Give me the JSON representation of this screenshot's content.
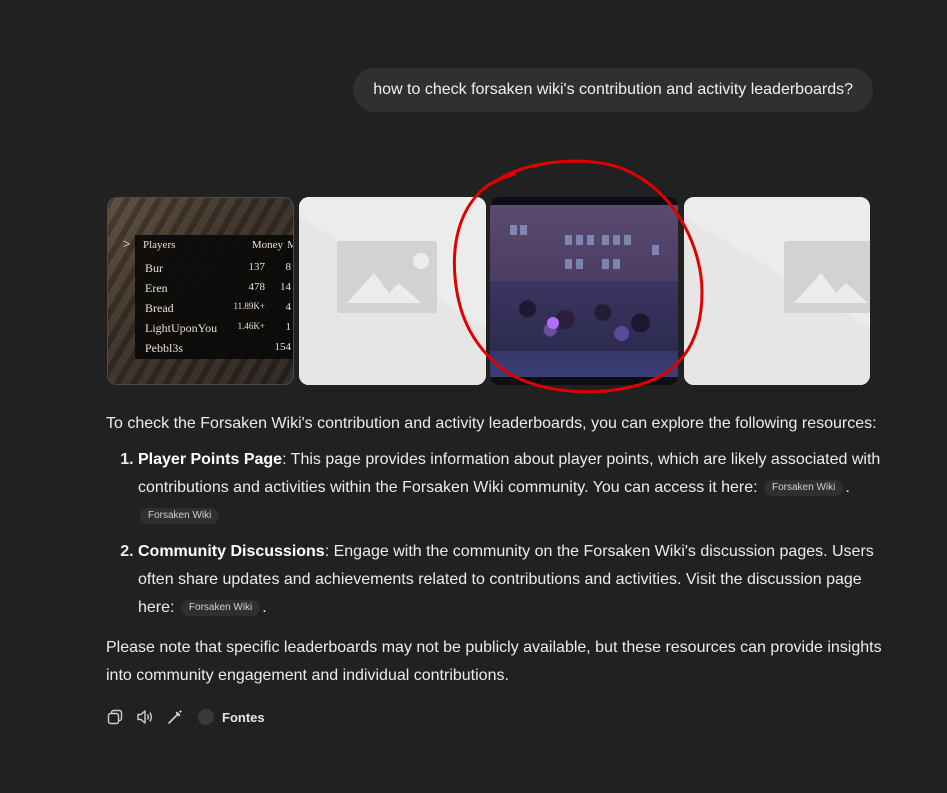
{
  "user_message": "how to check forsaken wiki's contribution and activity leaderboards?",
  "scoreboard": {
    "arrow": ">",
    "headers": [
      "Players",
      "Money",
      "M"
    ],
    "rows": [
      {
        "name": "Bur",
        "money": "137",
        "m": "8"
      },
      {
        "name": "Eren",
        "money": "478",
        "m": "14"
      },
      {
        "name": "Bread",
        "money": "11.89K+",
        "m": "4"
      },
      {
        "name": "LightUponYou",
        "money": "1.46K+",
        "m": "1"
      },
      {
        "name": "Pebbl3s",
        "money": "",
        "m": "154"
      }
    ]
  },
  "answer": {
    "intro": "To check the Forsaken Wiki's contribution and activity leaderboards, you can explore the following resources:",
    "items": [
      {
        "title": "Player Points Page",
        "text": ": This page provides information about player points, which are likely associated with contributions and activities within the Forsaken Wiki community. You can access it here: ",
        "sources": [
          "Forsaken Wiki",
          "Forsaken Wiki"
        ]
      },
      {
        "title": "Community Discussions",
        "text": ": Engage with the community on the Forsaken Wiki's discussion pages. Users often share updates and achievements related to contributions and activities. Visit the discussion page here: ",
        "sources": [
          "Forsaken Wiki"
        ]
      }
    ],
    "note": "Please note that specific leaderboards may not be publicly available, but these resources can provide insights into community engagement and individual contributions."
  },
  "actions": {
    "copy_icon": "copy-icon",
    "speaker_icon": "speaker-icon",
    "edit_icon": "magic-pen-icon",
    "sources_label": "Fontes"
  },
  "colors": {
    "background": "#212121",
    "bubble": "#303030",
    "annotation": "#e00000"
  }
}
